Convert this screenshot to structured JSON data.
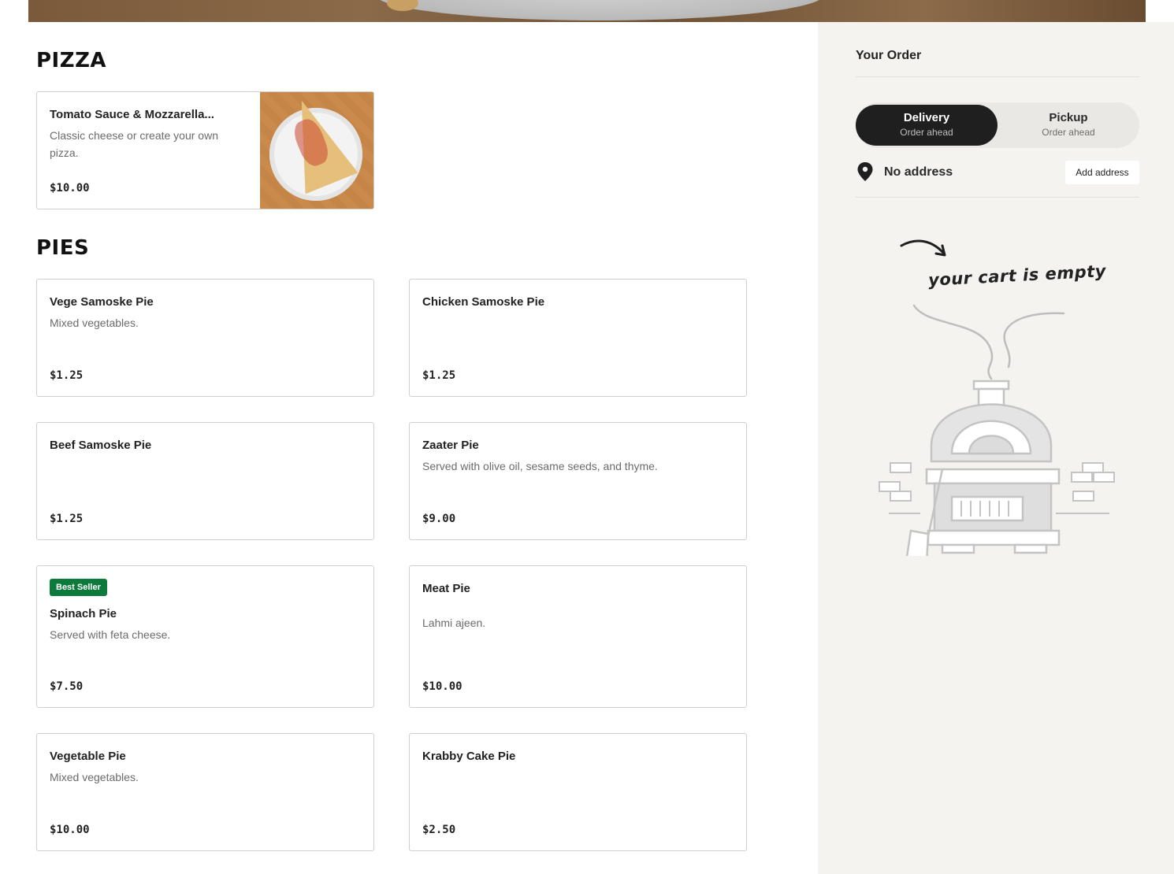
{
  "sections": [
    {
      "title": "PIZZA",
      "items": [
        {
          "name": "Tomato Sauce & Mozzarella...",
          "description_lines": [
            "Classic cheese or create your own",
            "pizza."
          ],
          "price": "$10.00"
        }
      ]
    },
    {
      "title": "PIES",
      "items": [
        {
          "name": "Vege Samoske Pie",
          "description": "Mixed vegetables.",
          "price": "$1.25"
        },
        {
          "name": "Chicken Samoske Pie",
          "description": "",
          "price": "$1.25"
        },
        {
          "name": "Beef Samoske Pie",
          "description": "",
          "price": "$1.25"
        },
        {
          "name": "Zaater Pie",
          "description": "Served with olive oil, sesame seeds, and thyme.",
          "price": "$9.00"
        },
        {
          "badge": "Best Seller",
          "name": "Spinach Pie",
          "description": "Served with feta cheese.",
          "price": "$7.50"
        },
        {
          "name": "Meat Pie",
          "description": "Lahmi ajeen.",
          "price": "$10.00"
        },
        {
          "name": "Vegetable Pie",
          "description": "Mixed vegetables.",
          "price": "$10.00"
        },
        {
          "name": "Krabby Cake Pie",
          "description": "",
          "price": "$2.50"
        }
      ]
    }
  ],
  "order": {
    "title": "Your Order",
    "modes": [
      {
        "label": "Delivery",
        "sublabel": "Order ahead",
        "selected": true
      },
      {
        "label": "Pickup",
        "sublabel": "Order ahead",
        "selected": false
      }
    ],
    "address_status": "No address",
    "add_address_label": "Add address",
    "empty_message": "your cart is empty"
  },
  "colors": {
    "accent_dark": "#1f1f1f",
    "badge_green": "#0b7a3a",
    "sidebar_bg": "#f4f3f0"
  },
  "icons": [
    "location-pin-icon",
    "arrow-icon",
    "pizza-oven-illustration"
  ]
}
